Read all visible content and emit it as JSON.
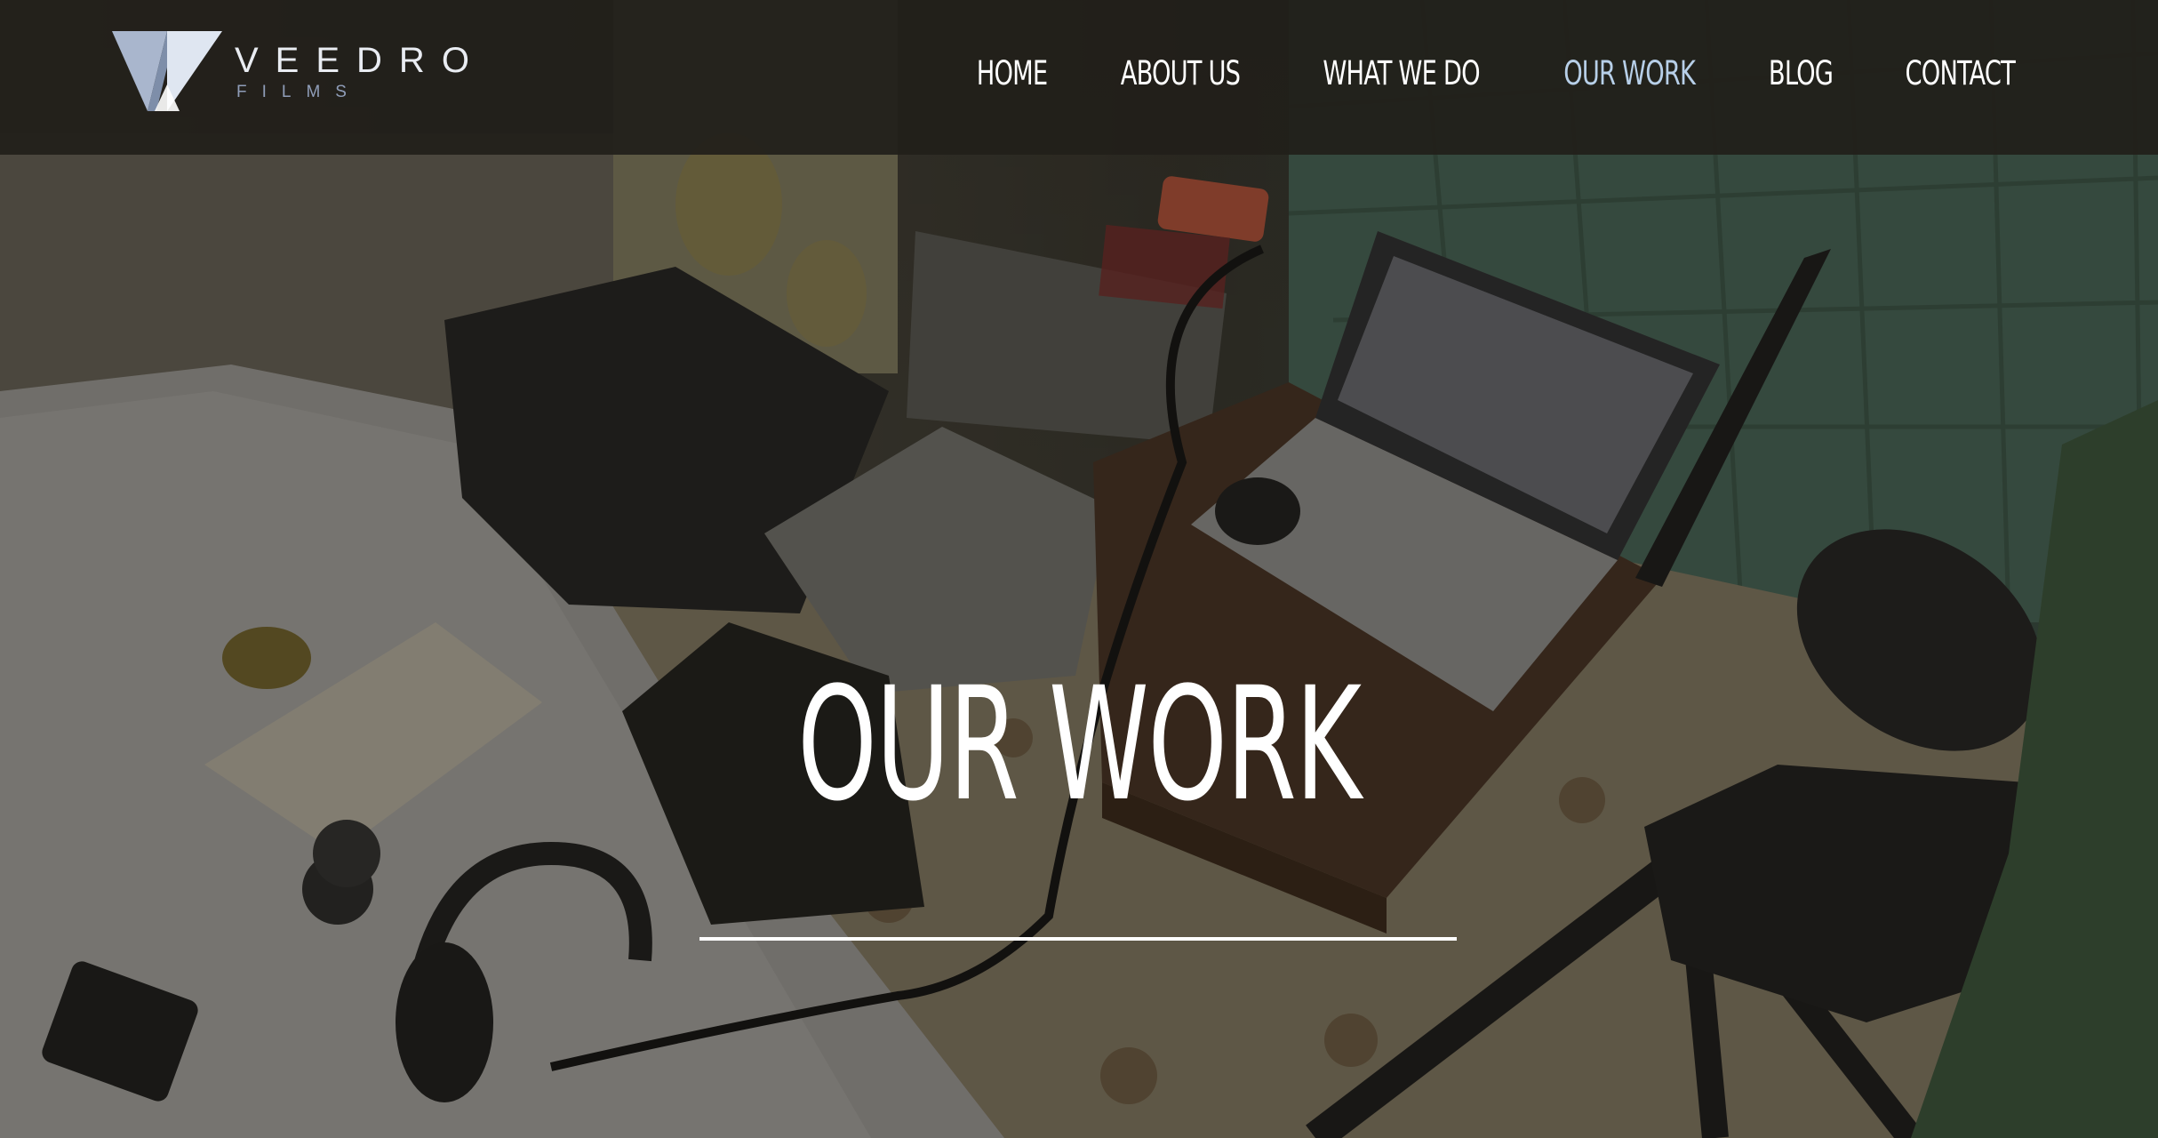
{
  "brand": {
    "name": "VEEDRO",
    "subname": "FILMS",
    "logo_icon": "veedro-v-logo",
    "colors": {
      "mark_light": "#dfe6f1",
      "mark_mid": "#a9b6cd",
      "mark_dark": "#7e8ea9"
    }
  },
  "nav": {
    "items": [
      {
        "label": "HOME",
        "active": false
      },
      {
        "label": "ABOUT US",
        "active": false
      },
      {
        "label": "WHAT WE DO",
        "active": false
      },
      {
        "label": "OUR WORK",
        "active": true
      },
      {
        "label": "BLOG",
        "active": false
      },
      {
        "label": "CONTACT",
        "active": false
      }
    ],
    "active_color": "#b7cfe8",
    "color": "#ffffff"
  },
  "hero": {
    "title": "OUR WORK",
    "background": "filmmaking gear photo",
    "header_bg": "#211f1a"
  }
}
